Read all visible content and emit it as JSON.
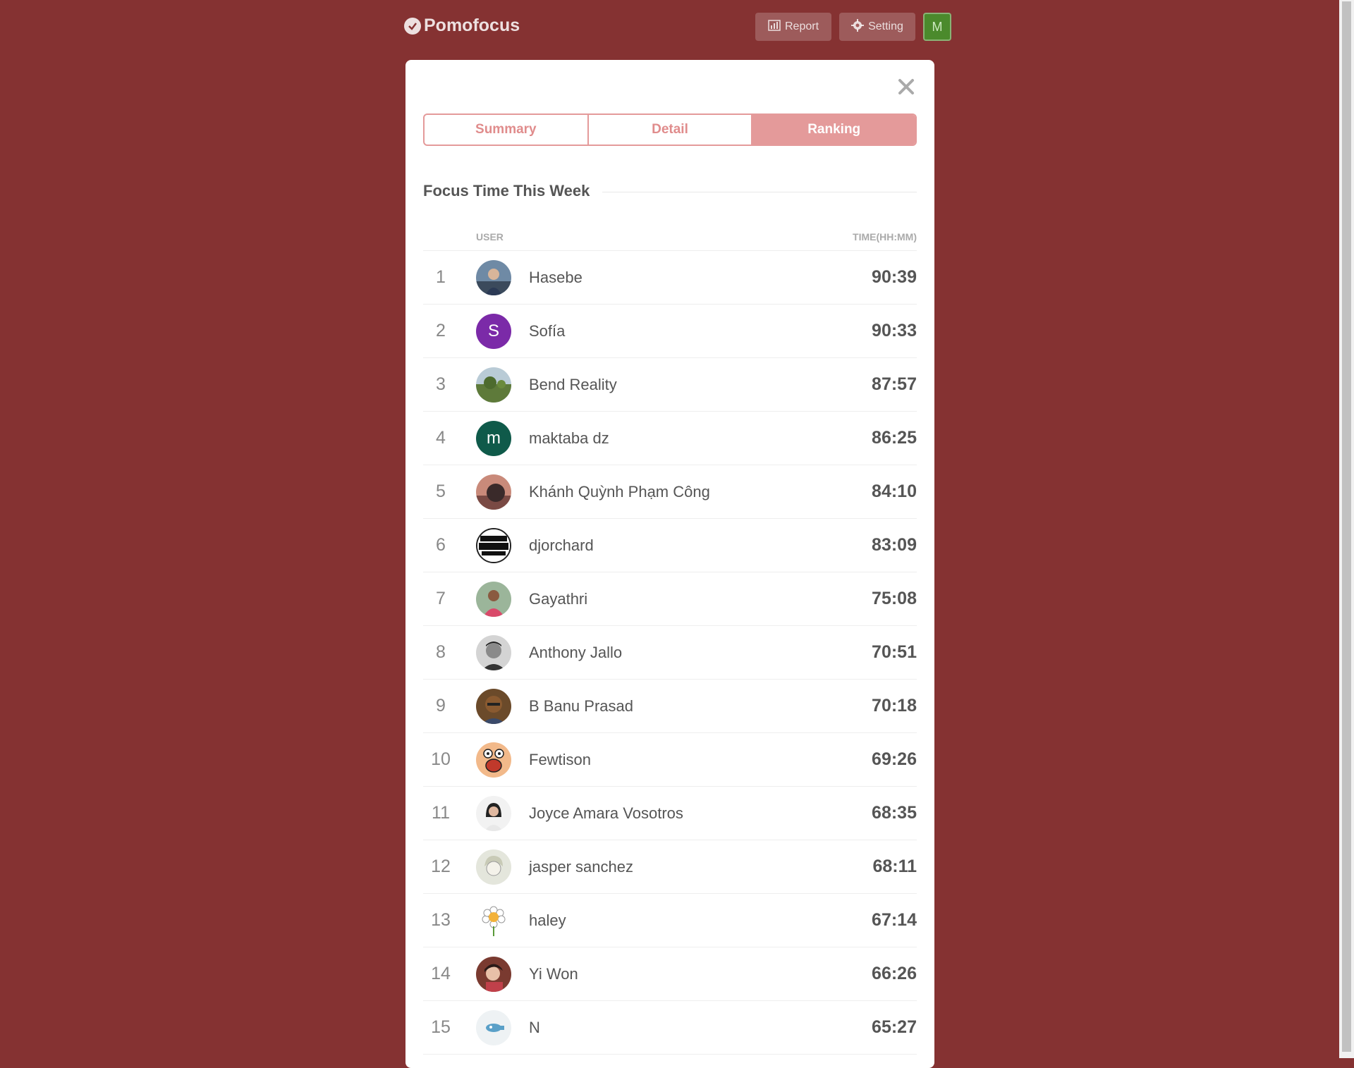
{
  "app": {
    "logo_text": "Pomofocus",
    "logo_icon": "check-circle-icon"
  },
  "header": {
    "report_label": "Report",
    "report_icon": "bar-chart-icon",
    "setting_label": "Setting",
    "setting_icon": "gear-icon",
    "user_initial": "M"
  },
  "modal": {
    "close_icon": "close-icon",
    "tabs": [
      {
        "label": "Summary",
        "active": false
      },
      {
        "label": "Detail",
        "active": false
      },
      {
        "label": "Ranking",
        "active": true
      }
    ],
    "section_title": "Focus Time This Week",
    "columns": {
      "user": "USER",
      "time": "TIME(HH:MM)"
    },
    "rows": [
      {
        "rank": "1",
        "name": "Hasebe",
        "time": "90:39",
        "avatar": "photo"
      },
      {
        "rank": "2",
        "name": "Sofía",
        "time": "90:33",
        "avatar": "letter",
        "letter": "S"
      },
      {
        "rank": "3",
        "name": "Bend Reality",
        "time": "87:57",
        "avatar": "photo"
      },
      {
        "rank": "4",
        "name": "maktaba dz",
        "time": "86:25",
        "avatar": "letter",
        "letter": "m"
      },
      {
        "rank": "5",
        "name": "Khánh Quỳnh Phạm Công",
        "time": "84:10",
        "avatar": "photo"
      },
      {
        "rank": "6",
        "name": "djorchard",
        "time": "83:09",
        "avatar": "photo"
      },
      {
        "rank": "7",
        "name": "Gayathri",
        "time": "75:08",
        "avatar": "photo"
      },
      {
        "rank": "8",
        "name": "Anthony Jallo",
        "time": "70:51",
        "avatar": "photo"
      },
      {
        "rank": "9",
        "name": "B Banu Prasad",
        "time": "70:18",
        "avatar": "photo"
      },
      {
        "rank": "10",
        "name": "Fewtison",
        "time": "69:26",
        "avatar": "photo"
      },
      {
        "rank": "11",
        "name": "Joyce Amara Vosotros",
        "time": "68:35",
        "avatar": "photo"
      },
      {
        "rank": "12",
        "name": "jasper sanchez",
        "time": "68:11",
        "avatar": "photo"
      },
      {
        "rank": "13",
        "name": "haley",
        "time": "67:14",
        "avatar": "photo"
      },
      {
        "rank": "14",
        "name": "Yi Won",
        "time": "66:26",
        "avatar": "photo"
      },
      {
        "rank": "15",
        "name": "N",
        "time": "65:27",
        "avatar": "photo"
      }
    ]
  },
  "colors": {
    "background": "#853232",
    "accent": "#e49a9a",
    "user_avatar_bg": "#4b8a2c",
    "sofia_avatar": "#7b2aa8",
    "maktaba_avatar": "#0f5a4a"
  }
}
